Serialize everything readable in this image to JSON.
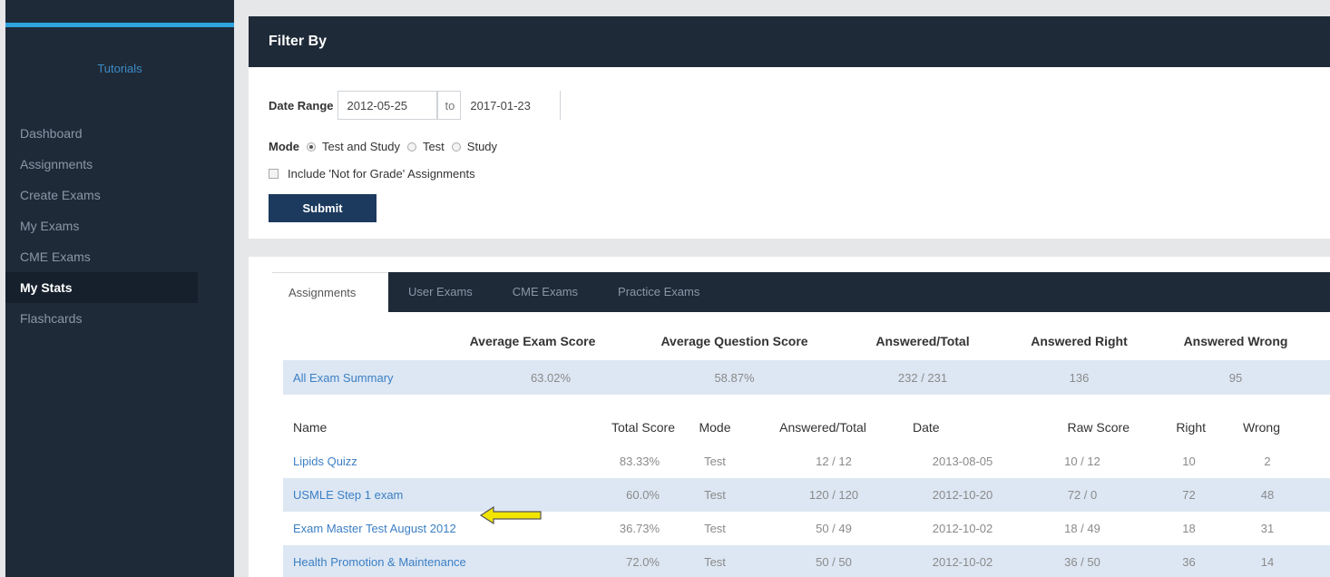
{
  "sidebar": {
    "brand": "Tutorials",
    "items": [
      {
        "label": "Dashboard",
        "active": false
      },
      {
        "label": "Assignments",
        "active": false
      },
      {
        "label": "Create Exams",
        "active": false
      },
      {
        "label": "My Exams",
        "active": false
      },
      {
        "label": "CME Exams",
        "active": false
      },
      {
        "label": "My Stats",
        "active": true
      },
      {
        "label": "Flashcards",
        "active": false
      }
    ]
  },
  "filter": {
    "title": "Filter By",
    "date_range_label": "Date Range",
    "date_from": "2012-05-25",
    "to_label": "to",
    "date_to": "2017-01-23",
    "mode_label": "Mode",
    "mode_options": [
      "Test and Study",
      "Test",
      "Study"
    ],
    "mode_selected": "Test and Study",
    "include_label": "Include 'Not for Grade' Assignments",
    "submit_label": "Submit"
  },
  "tabs": [
    "Assignments",
    "User Exams",
    "CME Exams",
    "Practice Exams"
  ],
  "summary": {
    "headers": [
      "Average Exam Score",
      "Average Question Score",
      "Answered/Total",
      "Answered Right",
      "Answered Wrong"
    ],
    "row": {
      "name": "All Exam Summary",
      "avg_exam": "63.02%",
      "avg_question": "58.87%",
      "answered_total": "232 / 231",
      "right": "136",
      "wrong": "95"
    }
  },
  "exams": {
    "headers": [
      "Name",
      "Total Score",
      "Mode",
      "Answered/Total",
      "Date",
      "Raw Score",
      "Right",
      "Wrong"
    ],
    "rows": [
      {
        "name": "Lipids Quizz",
        "total": "83.33%",
        "mode": "Test",
        "answered": "12 / 12",
        "date": "2013-08-05",
        "raw": "10 / 12",
        "right": "10",
        "wrong": "2"
      },
      {
        "name": "USMLE Step 1 exam",
        "total": "60.0%",
        "mode": "Test",
        "answered": "120 / 120",
        "date": "2012-10-20",
        "raw": "72 / 0",
        "right": "72",
        "wrong": "48"
      },
      {
        "name": "Exam Master Test August 2012",
        "total": "36.73%",
        "mode": "Test",
        "answered": "50 / 49",
        "date": "2012-10-02",
        "raw": "18 / 49",
        "right": "18",
        "wrong": "31"
      },
      {
        "name": "Health Promotion & Maintenance",
        "total": "72.0%",
        "mode": "Test",
        "answered": "50 / 50",
        "date": "2012-10-02",
        "raw": "36 / 50",
        "right": "36",
        "wrong": "14"
      }
    ]
  },
  "colors": {
    "sidebar_bg": "#1f2a38",
    "accent": "#2fa3de",
    "link": "#3b7fc4",
    "row_highlight": "#dde7f3",
    "submit_bg": "#1c3a5e",
    "arrow": "#f2e600"
  },
  "annotation": {
    "icon": "arrow-left-icon"
  }
}
